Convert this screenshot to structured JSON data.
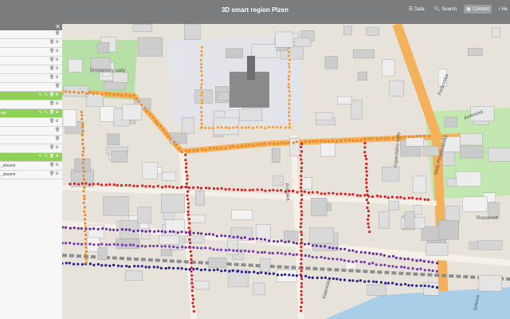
{
  "header": {
    "title": "3D smart region Plzen",
    "nav": [
      {
        "icon": "data-icon",
        "label": "Data"
      },
      {
        "icon": "search-icon",
        "label": "Search"
      },
      {
        "icon": "content-icon",
        "label": "Content"
      },
      {
        "icon": "help-icon",
        "label": "He"
      }
    ]
  },
  "sidebar": {
    "rows": [
      {
        "label": "",
        "green": false,
        "icons": [
          "trash"
        ]
      },
      {
        "label": "",
        "green": false,
        "icons": [
          "trash",
          "gear"
        ]
      },
      {
        "label": "",
        "green": false,
        "icons": [
          "trash",
          "gear"
        ]
      },
      {
        "label": "",
        "green": false,
        "icons": [
          "trash",
          "gear"
        ]
      },
      {
        "label": "",
        "green": false,
        "icons": [
          "trash",
          "gear"
        ]
      },
      {
        "label": "",
        "green": false,
        "icons": [
          "trash",
          "gear"
        ]
      },
      {
        "label": "",
        "green": false,
        "icons": [
          "trash"
        ]
      },
      {
        "label": "",
        "green": true,
        "icons": [
          "edit",
          "zoom",
          "trash",
          "gear"
        ]
      },
      {
        "label": "",
        "green": false,
        "icons": [
          "trash",
          "gear"
        ]
      },
      {
        "label": "ata",
        "green": true,
        "icons": [
          "edit",
          "zoom",
          "trash",
          "gear"
        ]
      },
      {
        "label": "",
        "green": false,
        "icons": [
          "trash",
          "gear"
        ]
      },
      {
        "label": "",
        "green": false,
        "icons": [
          "trash"
        ]
      },
      {
        "label": "",
        "green": false,
        "icons": [
          "trash"
        ]
      },
      {
        "label": "",
        "green": false,
        "icons": [
          "trash",
          "gear"
        ]
      },
      {
        "label": "",
        "green": true,
        "icons": [
          "edit",
          "zoom",
          "trash",
          "gear"
        ]
      },
      {
        "label": "_vlozeni",
        "green": false,
        "icons": [
          "trash",
          "gear"
        ]
      },
      {
        "label": "_vlozeni",
        "green": false,
        "icons": [
          "trash",
          "gear"
        ]
      }
    ]
  },
  "map": {
    "street_labels": [
      "Prešovská",
      "Pražská",
      "Sady Pětatřicátníků",
      "Klatovská",
      "Sirkova",
      "Americká",
      "Smetanovy sady",
      "Roosevelt.",
      "Kopeckého sady"
    ]
  },
  "colors": {
    "topbar": "#7b7c7e",
    "green": "#8fd156",
    "orange": "#f0a040",
    "red": "#d8201c",
    "purple": "#6a2a9a",
    "street": "#f2a93b"
  }
}
